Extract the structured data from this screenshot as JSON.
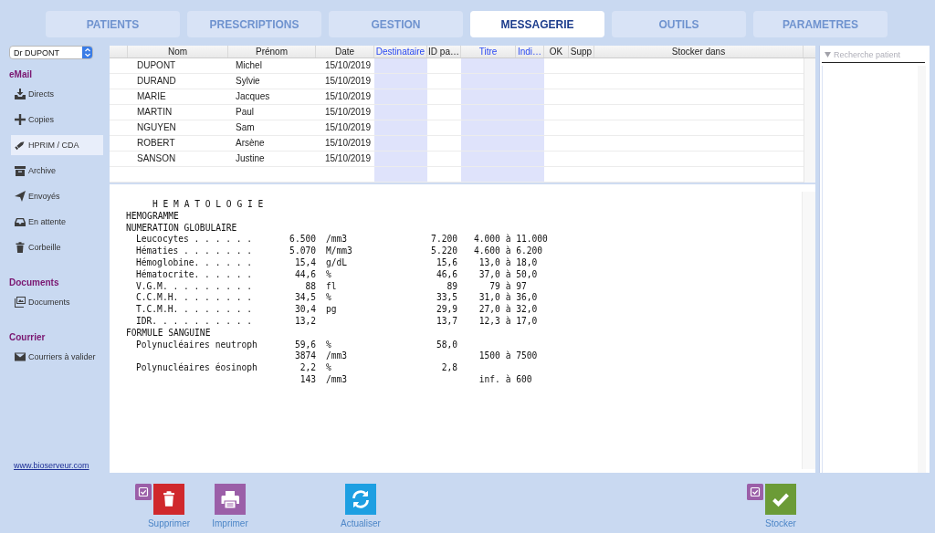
{
  "tabs": [
    {
      "label": "PATIENTS",
      "selected": false
    },
    {
      "label": "PRESCRIPTIONS",
      "selected": false
    },
    {
      "label": "GESTION",
      "selected": false
    },
    {
      "label": "MESSAGERIE",
      "selected": true
    },
    {
      "label": "OUTILS",
      "selected": false
    },
    {
      "label": "PARAMETRES",
      "selected": false
    }
  ],
  "doctor_select": {
    "value": "Dr DUPONT"
  },
  "sidebar": {
    "sections": [
      {
        "title": "eMail",
        "items": [
          {
            "label": "Directs",
            "selected": false
          },
          {
            "label": "Copies",
            "selected": false
          },
          {
            "label": "HPRIM / CDA",
            "selected": true
          },
          {
            "label": "Archive",
            "selected": false
          },
          {
            "label": "Envoyés",
            "selected": false
          },
          {
            "label": "En attente",
            "selected": false
          },
          {
            "label": "Corbeille",
            "selected": false
          }
        ]
      },
      {
        "title": "Documents",
        "items": [
          {
            "label": "Documents",
            "selected": false
          }
        ]
      },
      {
        "title": "Courrier",
        "items": [
          {
            "label": "Courriers à valider",
            "selected": false
          }
        ]
      }
    ],
    "link": "www.bioserveur.com"
  },
  "table": {
    "columns": [
      {
        "label": "Nom",
        "highlighted": false
      },
      {
        "label": "Prénom",
        "highlighted": false
      },
      {
        "label": "Date",
        "highlighted": false
      },
      {
        "label": "Destinataire",
        "highlighted": true
      },
      {
        "label": "ID pa…",
        "highlighted": false
      },
      {
        "label": "Titre",
        "highlighted": true
      },
      {
        "label": "Indi…",
        "highlighted": true
      },
      {
        "label": "OK",
        "highlighted": false
      },
      {
        "label": "Supp",
        "highlighted": false
      },
      {
        "label": "Stocker dans",
        "highlighted": false
      }
    ],
    "rows": [
      {
        "cells": [
          "DUPONT",
          "Michel",
          "15/10/2019"
        ],
        "selected": false
      },
      {
        "cells": [
          "DURAND",
          "Sylvie",
          "15/10/2019"
        ],
        "selected": false
      },
      {
        "cells": [
          "MARIE",
          "Jacques",
          "15/10/2019"
        ],
        "selected": false
      },
      {
        "cells": [
          "MARTIN",
          "Paul",
          "15/10/2019"
        ],
        "selected": false
      },
      {
        "cells": [
          "NGUYEN",
          "Sam",
          "15/10/2019"
        ],
        "selected": false
      },
      {
        "cells": [
          "ROBERT",
          "Arsène",
          "15/10/2019"
        ],
        "selected": false
      },
      {
        "cells": [
          "SANSON",
          "Justine",
          "15/10/2019"
        ],
        "selected": false
      }
    ]
  },
  "report": {
    "lines": [
      {
        "kind": "title",
        "text": "H E M A T O L O G I E"
      },
      {
        "kind": "heading",
        "text": "HEMOGRAMME"
      },
      {
        "kind": "heading",
        "text": "NUMERATION GLOBULAIRE"
      },
      {
        "kind": "result",
        "label": "Leucocytes . . . . . .",
        "value": "6.500",
        "unit": "/mm3",
        "value_2": "7.200",
        "range_low": "4.000",
        "range_word": "à",
        "range_high": "11.000"
      },
      {
        "kind": "result",
        "label": "Hématies . . . . . . .",
        "value": "5.070",
        "unit": "M/mm3",
        "value_2": "5.220",
        "range_low": "4.600",
        "range_word": "à",
        "range_high": "6.200"
      },
      {
        "kind": "result",
        "label": "Hémoglobine. . . . . .",
        "value": "15,4",
        "unit": "g/dL",
        "value_2": "15,6",
        "range_low": "13,0",
        "range_word": "à",
        "range_high": "18,0"
      },
      {
        "kind": "result",
        "label": "Hématocrite. . . . . .",
        "value": "44,6",
        "unit": "%",
        "value_2": "46,6",
        "range_low": "37,0",
        "range_word": "à",
        "range_high": "50,0"
      },
      {
        "kind": "result",
        "label": "V.G.M. . . . . . . . .",
        "value": "88",
        "unit": "fl",
        "value_2": "89",
        "range_low": "79",
        "range_word": "à",
        "range_high": "97"
      },
      {
        "kind": "result",
        "label": "C.C.M.H. . . . . . . .",
        "value": "34,5",
        "unit": "%",
        "value_2": "33,5",
        "range_low": "31,0",
        "range_word": "à",
        "range_high": "36,0"
      },
      {
        "kind": "result",
        "label": "T.C.M.H. . . . . . . .",
        "value": "30,4",
        "unit": "pg",
        "value_2": "29,9",
        "range_low": "27,0",
        "range_word": "à",
        "range_high": "32,0"
      },
      {
        "kind": "result",
        "label": "IDR. . . . . . . . . .",
        "value": "13,2",
        "value_2": "13,7",
        "range_low": "12,3",
        "range_word": "à",
        "range_high": "17,0"
      },
      {
        "kind": "heading",
        "text": "FORMULE SANGUINE"
      },
      {
        "kind": "result",
        "label": "Polynucléaires neutroph",
        "value": "59,6",
        "unit": "%",
        "value_2": "58,0"
      },
      {
        "kind": "result",
        "value": "3874",
        "unit": "/mm3",
        "range_low": "1500",
        "range_word": "à",
        "range_high": "7500"
      },
      {
        "kind": "result",
        "label": "Polynucléaires éosinoph",
        "value": "2,2",
        "unit": "%",
        "value_2": "2,8"
      },
      {
        "kind": "result",
        "value": "143",
        "unit": "/mm3",
        "range_low": "inf.",
        "range_word": "à",
        "range_high": "600"
      }
    ]
  },
  "patient_search": {
    "placeholder": "Recherche patient"
  },
  "actions": [
    {
      "label": "Supprimer",
      "checkbox": {
        "checked": true
      }
    },
    {
      "label": "Imprimer"
    },
    {
      "label": "Actualiser"
    },
    {
      "label": "Stocker",
      "checkbox": {
        "checked": true
      }
    }
  ]
}
